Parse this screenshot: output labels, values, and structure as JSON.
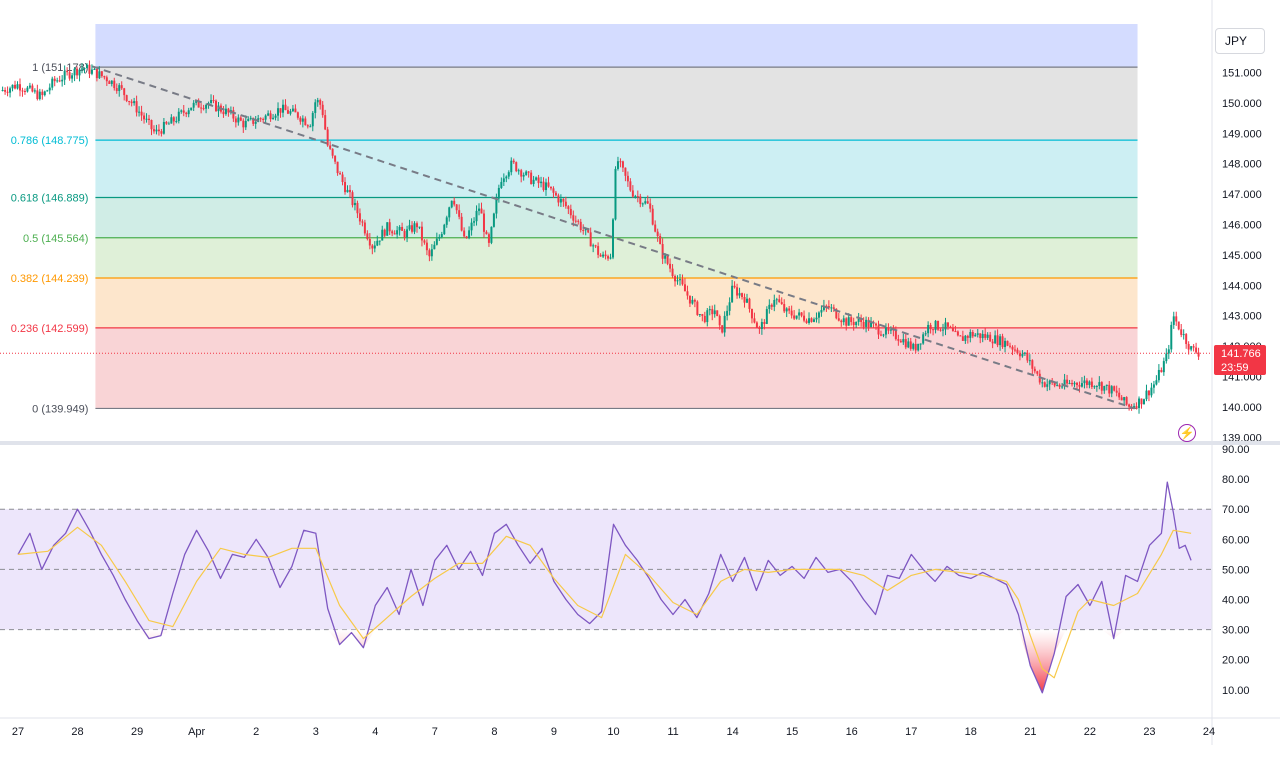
{
  "symbol": {
    "currency": "JPY"
  },
  "last_price": {
    "price": "141.766",
    "countdown": "23:59"
  },
  "chart_data": [
    {
      "type": "candlestick",
      "price_axis": {
        "ticks": [
          151.0,
          150.0,
          149.0,
          148.0,
          147.0,
          146.0,
          145.0,
          144.0,
          143.0,
          142.0,
          141.0,
          140.0,
          139.0
        ],
        "range": [
          139.0,
          151.9
        ],
        "tick_decimals": 3
      },
      "x_axis": {
        "ticks": [
          {
            "label": "27",
            "day": 0
          },
          {
            "label": "28",
            "day": 1
          },
          {
            "label": "29",
            "day": 2
          },
          {
            "label": "Apr",
            "day": 3
          },
          {
            "label": "2",
            "day": 4
          },
          {
            "label": "3",
            "day": 5
          },
          {
            "label": "4",
            "day": 6
          },
          {
            "label": "7",
            "day": 7
          },
          {
            "label": "8",
            "day": 8
          },
          {
            "label": "9",
            "day": 9
          },
          {
            "label": "10",
            "day": 10
          },
          {
            "label": "11",
            "day": 11
          },
          {
            "label": "14",
            "day": 12
          },
          {
            "label": "15",
            "day": 13
          },
          {
            "label": "16",
            "day": 14
          },
          {
            "label": "17",
            "day": 15
          },
          {
            "label": "18",
            "day": 16
          },
          {
            "label": "21",
            "day": 17
          },
          {
            "label": "22",
            "day": 18
          },
          {
            "label": "23",
            "day": 19
          },
          {
            "label": "24",
            "day": 20
          }
        ]
      },
      "fib_start_day": 1.3,
      "fib_end_day": 18.8,
      "fib_levels": [
        {
          "ratio": "1",
          "price": 151.178,
          "label": "1 (151.178)",
          "color": "#787b86",
          "fill": "#e3e3e3"
        },
        {
          "ratio": "0.786",
          "price": 148.775,
          "label": "0.786 (148.775)",
          "color": "#00bcd4",
          "fill": "#cdeff3"
        },
        {
          "ratio": "0.618",
          "price": 146.889,
          "label": "0.618 (146.889)",
          "color": "#089981",
          "fill": "#d0ede6"
        },
        {
          "ratio": "0.5",
          "price": 145.564,
          "label": "0.5 (145.564)",
          "color": "#4caf50",
          "fill": "#dff0d8"
        },
        {
          "ratio": "0.382",
          "price": 144.239,
          "label": "0.382 (144.239)",
          "color": "#ff9800",
          "fill": "#fde6cc"
        },
        {
          "ratio": "0.236",
          "price": 142.599,
          "label": "0.236 (142.599)",
          "color": "#f23645",
          "fill": "#f9d4d6"
        },
        {
          "ratio": "0",
          "price": 139.949,
          "label": "0 (139.949)",
          "color": "#787b86",
          "fill": null
        }
      ],
      "top_band_fill": "#d4dcff",
      "trend_line": [
        {
          "day": 1.25,
          "price": 151.2
        },
        {
          "day": 18.75,
          "price": 139.95
        }
      ],
      "last_price": 141.766,
      "colors": {
        "up": "#089981",
        "down": "#f23645",
        "trend": "#787b86"
      },
      "price_path": [
        [
          -0.3,
          150.4
        ],
        [
          0.0,
          150.6
        ],
        [
          0.4,
          150.2
        ],
        [
          0.6,
          150.7
        ],
        [
          0.9,
          151.0
        ],
        [
          1.1,
          151.17
        ],
        [
          1.5,
          150.8
        ],
        [
          1.7,
          150.5
        ],
        [
          2.0,
          149.8
        ],
        [
          2.3,
          149.0
        ],
        [
          2.6,
          149.4
        ],
        [
          2.9,
          149.9
        ],
        [
          3.2,
          150.0
        ],
        [
          3.5,
          149.7
        ],
        [
          3.8,
          149.3
        ],
        [
          4.1,
          149.5
        ],
        [
          4.4,
          149.8
        ],
        [
          4.7,
          149.6
        ],
        [
          4.9,
          149.3
        ],
        [
          5.0,
          150.1
        ],
        [
          5.1,
          149.9
        ],
        [
          5.2,
          148.6
        ],
        [
          5.4,
          147.6
        ],
        [
          5.7,
          146.4
        ],
        [
          5.95,
          145.3
        ],
        [
          6.2,
          145.9
        ],
        [
          6.5,
          145.7
        ],
        [
          6.7,
          146.0
        ],
        [
          6.9,
          144.9
        ],
        [
          7.1,
          145.7
        ],
        [
          7.3,
          147.0
        ],
        [
          7.5,
          145.4
        ],
        [
          7.75,
          146.6
        ],
        [
          7.9,
          145.2
        ],
        [
          8.1,
          147.5
        ],
        [
          8.3,
          148.0
        ],
        [
          8.6,
          147.5
        ],
        [
          8.9,
          147.2
        ],
        [
          9.2,
          146.6
        ],
        [
          9.5,
          145.8
        ],
        [
          9.8,
          144.9
        ],
        [
          9.95,
          145.0
        ],
        [
          10.05,
          148.2
        ],
        [
          10.3,
          147.1
        ],
        [
          10.6,
          146.6
        ],
        [
          10.8,
          145.1
        ],
        [
          11.0,
          144.4
        ],
        [
          11.2,
          143.8
        ],
        [
          11.5,
          142.9
        ],
        [
          11.7,
          143.2
        ],
        [
          11.8,
          142.4
        ],
        [
          12.0,
          143.9
        ],
        [
          12.2,
          143.6
        ],
        [
          12.45,
          142.5
        ],
        [
          12.7,
          143.6
        ],
        [
          12.9,
          143.1
        ],
        [
          13.3,
          142.9
        ],
        [
          13.6,
          143.3
        ],
        [
          13.9,
          142.8
        ],
        [
          14.2,
          142.8
        ],
        [
          14.5,
          142.5
        ],
        [
          14.8,
          142.3
        ],
        [
          15.05,
          141.9
        ],
        [
          15.3,
          142.7
        ],
        [
          15.6,
          142.6
        ],
        [
          15.8,
          142.2
        ],
        [
          16.0,
          142.4
        ],
        [
          16.3,
          142.3
        ],
        [
          16.6,
          142.1
        ],
        [
          16.9,
          141.7
        ],
        [
          17.2,
          140.8
        ],
        [
          17.5,
          140.7
        ],
        [
          17.8,
          140.8
        ],
        [
          18.1,
          140.8
        ],
        [
          18.4,
          140.5
        ],
        [
          18.65,
          140.0
        ],
        [
          18.85,
          140.2
        ],
        [
          19.1,
          140.8
        ],
        [
          19.3,
          141.7
        ],
        [
          19.4,
          143.0
        ],
        [
          19.5,
          142.6
        ],
        [
          19.7,
          141.9
        ],
        [
          19.85,
          141.766
        ]
      ]
    },
    {
      "type": "line",
      "y_axis": {
        "ticks": [
          90,
          80,
          70,
          60,
          50,
          40,
          30,
          20,
          10
        ],
        "range": [
          5,
          93
        ],
        "tick_decimals": 2
      },
      "band": {
        "upper": 70,
        "middle": 50,
        "lower": 30,
        "fill": "#ede6fb"
      },
      "series": [
        {
          "role": "rsi",
          "color": "#7e57c2",
          "values": [
            [
              0.0,
              55
            ],
            [
              0.2,
              62
            ],
            [
              0.4,
              50
            ],
            [
              0.6,
              58
            ],
            [
              0.8,
              62
            ],
            [
              1.0,
              70
            ],
            [
              1.2,
              63
            ],
            [
              1.4,
              55
            ],
            [
              1.6,
              48
            ],
            [
              1.8,
              40
            ],
            [
              2.0,
              33
            ],
            [
              2.2,
              27
            ],
            [
              2.4,
              28
            ],
            [
              2.6,
              42
            ],
            [
              2.8,
              55
            ],
            [
              3.0,
              63
            ],
            [
              3.2,
              56
            ],
            [
              3.4,
              47
            ],
            [
              3.6,
              55
            ],
            [
              3.8,
              54
            ],
            [
              4.0,
              60
            ],
            [
              4.2,
              54
            ],
            [
              4.4,
              44
            ],
            [
              4.6,
              51
            ],
            [
              4.8,
              63
            ],
            [
              5.0,
              62
            ],
            [
              5.2,
              37
            ],
            [
              5.4,
              25
            ],
            [
              5.6,
              29
            ],
            [
              5.8,
              24
            ],
            [
              6.0,
              38
            ],
            [
              6.2,
              44
            ],
            [
              6.4,
              35
            ],
            [
              6.6,
              50
            ],
            [
              6.8,
              38
            ],
            [
              7.0,
              53
            ],
            [
              7.2,
              58
            ],
            [
              7.4,
              50
            ],
            [
              7.6,
              56
            ],
            [
              7.8,
              48
            ],
            [
              8.0,
              62
            ],
            [
              8.2,
              65
            ],
            [
              8.4,
              58
            ],
            [
              8.6,
              52
            ],
            [
              8.8,
              57
            ],
            [
              9.0,
              46
            ],
            [
              9.2,
              40
            ],
            [
              9.4,
              35
            ],
            [
              9.6,
              32
            ],
            [
              9.8,
              36
            ],
            [
              10.0,
              65
            ],
            [
              10.2,
              58
            ],
            [
              10.4,
              53
            ],
            [
              10.6,
              47
            ],
            [
              10.8,
              40
            ],
            [
              11.0,
              35
            ],
            [
              11.2,
              40
            ],
            [
              11.4,
              34
            ],
            [
              11.6,
              42
            ],
            [
              11.8,
              55
            ],
            [
              12.0,
              46
            ],
            [
              12.2,
              54
            ],
            [
              12.4,
              43
            ],
            [
              12.6,
              53
            ],
            [
              12.8,
              48
            ],
            [
              13.0,
              51
            ],
            [
              13.2,
              47
            ],
            [
              13.4,
              54
            ],
            [
              13.6,
              49
            ],
            [
              13.8,
              50
            ],
            [
              14.0,
              46
            ],
            [
              14.2,
              40
            ],
            [
              14.4,
              35
            ],
            [
              14.6,
              48
            ],
            [
              14.8,
              47
            ],
            [
              15.0,
              55
            ],
            [
              15.2,
              50
            ],
            [
              15.4,
              46
            ],
            [
              15.6,
              51
            ],
            [
              15.8,
              48
            ],
            [
              16.0,
              47
            ],
            [
              16.2,
              49
            ],
            [
              16.4,
              47
            ],
            [
              16.6,
              45
            ],
            [
              16.8,
              35
            ],
            [
              17.0,
              18
            ],
            [
              17.2,
              9
            ],
            [
              17.4,
              22
            ],
            [
              17.6,
              41
            ],
            [
              17.8,
              45
            ],
            [
              18.0,
              38
            ],
            [
              18.2,
              46
            ],
            [
              18.4,
              27
            ],
            [
              18.6,
              48
            ],
            [
              18.8,
              46
            ],
            [
              19.0,
              58
            ],
            [
              19.2,
              62
            ],
            [
              19.3,
              79
            ],
            [
              19.4,
              69
            ],
            [
              19.5,
              57
            ],
            [
              19.6,
              58
            ],
            [
              19.7,
              53
            ]
          ]
        },
        {
          "role": "rsi-ma",
          "color": "#f7c948",
          "values": [
            [
              0.0,
              55
            ],
            [
              0.5,
              56
            ],
            [
              1.0,
              64
            ],
            [
              1.4,
              58
            ],
            [
              1.8,
              46
            ],
            [
              2.2,
              33
            ],
            [
              2.6,
              31
            ],
            [
              3.0,
              46
            ],
            [
              3.4,
              57
            ],
            [
              3.8,
              55
            ],
            [
              4.2,
              54
            ],
            [
              4.6,
              57
            ],
            [
              5.0,
              57
            ],
            [
              5.4,
              38
            ],
            [
              5.8,
              27
            ],
            [
              6.2,
              34
            ],
            [
              6.6,
              41
            ],
            [
              7.0,
              47
            ],
            [
              7.4,
              52
            ],
            [
              7.8,
              52
            ],
            [
              8.2,
              61
            ],
            [
              8.6,
              58
            ],
            [
              9.0,
              47
            ],
            [
              9.4,
              38
            ],
            [
              9.8,
              34
            ],
            [
              10.2,
              55
            ],
            [
              10.6,
              48
            ],
            [
              11.0,
              39
            ],
            [
              11.4,
              35
            ],
            [
              11.8,
              46
            ],
            [
              12.2,
              50
            ],
            [
              12.6,
              49
            ],
            [
              13.0,
              50
            ],
            [
              13.4,
              50
            ],
            [
              13.8,
              50
            ],
            [
              14.2,
              48
            ],
            [
              14.6,
              43
            ],
            [
              15.0,
              48
            ],
            [
              15.4,
              50
            ],
            [
              15.8,
              49
            ],
            [
              16.2,
              48
            ],
            [
              16.6,
              46
            ],
            [
              16.8,
              40
            ],
            [
              17.0,
              28
            ],
            [
              17.2,
              17
            ],
            [
              17.4,
              14
            ],
            [
              17.6,
              25
            ],
            [
              17.8,
              36
            ],
            [
              18.0,
              40
            ],
            [
              18.4,
              38
            ],
            [
              18.8,
              42
            ],
            [
              19.2,
              55
            ],
            [
              19.4,
              63
            ],
            [
              19.7,
              62
            ]
          ]
        }
      ],
      "oversold_fill": "#f23645"
    }
  ]
}
